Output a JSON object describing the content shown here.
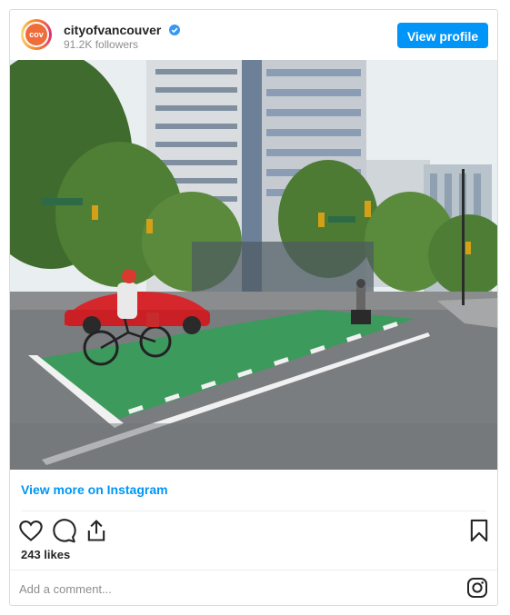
{
  "header": {
    "username": "cityofvancouver",
    "followers": "91.2K followers",
    "view_profile_label": "View profile",
    "verified_color": "#3897f0"
  },
  "post": {
    "view_more_label": "View more on Instagram",
    "likes": "243 likes",
    "comment_placeholder": "Add a comment..."
  },
  "icons": {
    "actions": [
      "heart-icon",
      "comment-icon",
      "share-icon"
    ],
    "save": "bookmark-icon",
    "brand": "instagram-icon"
  },
  "colors": {
    "accent": "#0095f6",
    "bike_lane": "#3c9a5c"
  }
}
